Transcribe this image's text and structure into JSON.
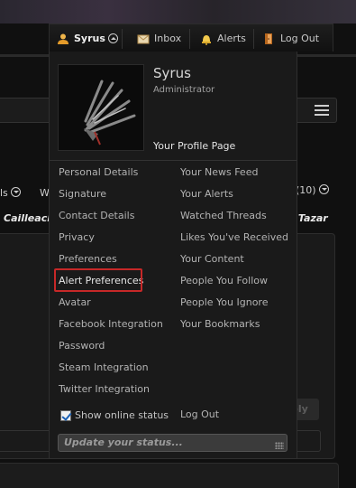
{
  "navbar": {
    "username": "Syrus",
    "inbox_label": "Inbox",
    "alerts_label": "Alerts",
    "logout_label": "Log Out"
  },
  "background": {
    "frag_ls": "ls",
    "frag_w": "W",
    "frag_count": "(10)",
    "frag_cailleach": "Cailleach",
    "frag_tazar": "h, Tazar",
    "frag_reply": "ply"
  },
  "profile": {
    "name": "Syrus",
    "role": "Administrator",
    "profile_link": "Your Profile Page"
  },
  "menu_left": [
    "Personal Details",
    "Signature",
    "Contact Details",
    "Privacy",
    "Preferences",
    "Alert Preferences",
    "Avatar",
    "Facebook Integration",
    "Password",
    "Steam Integration",
    "Twitter Integration"
  ],
  "menu_right": [
    "Your News Feed",
    "Your Alerts",
    "Watched Threads",
    "Likes You've Received",
    "Your Content",
    "People You Follow",
    "People You Ignore",
    "Your Bookmarks"
  ],
  "online_status_label": "Show online status",
  "online_status_checked": true,
  "menu_logout": "Log Out",
  "status_placeholder": "Update your status...",
  "colors": {
    "highlight_border": "#c62828",
    "menu_bg": "#1a1a1a",
    "page_bg": "#101010"
  },
  "icons": {
    "user": "user-icon",
    "inbox": "inbox-icon",
    "alerts": "bell-icon",
    "logout": "logout-icon",
    "dropdown": "chevron-up-icon"
  }
}
